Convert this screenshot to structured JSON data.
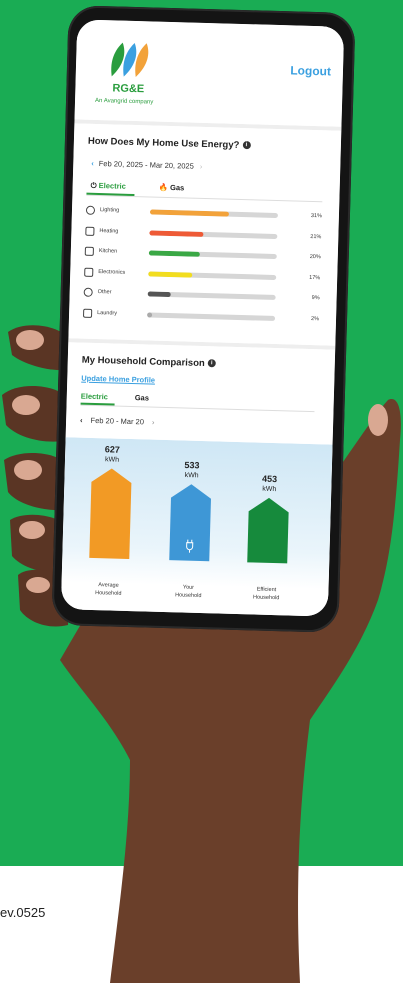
{
  "app": {
    "brand": "RG&E",
    "tagline": "An Avangrid company",
    "logout_label": "Logout"
  },
  "usage_card": {
    "title": "How Does My Home Use Energy?",
    "info_glyph": "i",
    "date_range": "Feb 20, 2025 - Mar 20, 2025",
    "tabs": [
      {
        "label": "Electric",
        "icon": "plug-icon"
      },
      {
        "label": "Gas",
        "icon": "flame-icon"
      }
    ],
    "rows": [
      {
        "label": "Lighting",
        "percent": "31%",
        "value": 31,
        "color": "#f2a23a",
        "icon": "bulb-icon"
      },
      {
        "label": "Heating",
        "percent": "21%",
        "value": 21,
        "color": "#ee5a36",
        "icon": "house-icon"
      },
      {
        "label": "Kitchen",
        "percent": "20%",
        "value": 20,
        "color": "#3aa845",
        "icon": "oven-icon"
      },
      {
        "label": "Electronics",
        "percent": "17%",
        "value": 17,
        "color": "#f2dd1f",
        "icon": "monitor-icon"
      },
      {
        "label": "Other",
        "percent": "9%",
        "value": 9,
        "color": "#555555",
        "icon": "other-icon"
      },
      {
        "label": "Laundry",
        "percent": "2%",
        "value": 2,
        "color": "#aaaaaa",
        "icon": "washer-icon"
      }
    ]
  },
  "comparison_card": {
    "title": "My Household Comparison",
    "info_glyph": "i",
    "update_link": "Update Home Profile",
    "tabs": [
      {
        "label": "Electric"
      },
      {
        "label": "Gas"
      }
    ],
    "date_range": "Feb 20 - Mar 20"
  },
  "chart_data": {
    "type": "bar",
    "categories": [
      "Average Household",
      "Your Household",
      "Efficient Household"
    ],
    "values": [
      627,
      533,
      453
    ],
    "value_labels": [
      "627",
      "533",
      "453"
    ],
    "unit": "kWh",
    "colors": [
      "#f29a25",
      "#3e97d6",
      "#168a3c"
    ],
    "ylim": [
      0,
      627
    ]
  },
  "footer": {
    "text": "ev.0525"
  },
  "colors": {
    "background_green": "#1aac54",
    "accent": "#3ba0e0"
  }
}
